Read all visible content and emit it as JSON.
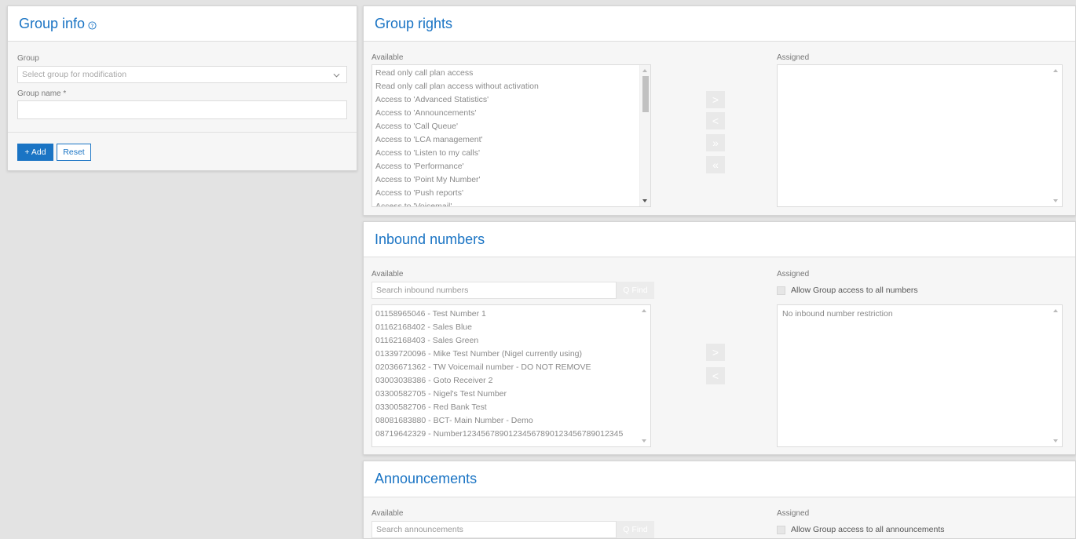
{
  "group_info": {
    "title": "Group info",
    "group_label": "Group",
    "group_placeholder": "Select group for modification",
    "group_name_label": "Group name *",
    "add_label": "+ Add",
    "reset_label": "Reset"
  },
  "group_rights": {
    "title": "Group rights",
    "available_label": "Available",
    "assigned_label": "Assigned",
    "available_items": [
      "Read only call plan access",
      "Read only call plan access without activation",
      "Access to 'Advanced Statistics'",
      "Access to 'Announcements'",
      "Access to 'Call Queue'",
      "Access to 'LCA management'",
      "Access to 'Listen to my calls'",
      "Access to 'Performance'",
      "Access to 'Point My Number'",
      "Access to 'Push reports'",
      "Access to 'Voicemail'"
    ],
    "arrows": [
      ">",
      "<",
      "»",
      "«"
    ]
  },
  "inbound_numbers": {
    "title": "Inbound numbers",
    "available_label": "Available",
    "assigned_label": "Assigned",
    "search_placeholder": "Search inbound numbers",
    "find_label": "Q Find",
    "allow_all_label": "Allow Group access to all numbers",
    "assigned_text": "No inbound number restriction",
    "available_items": [
      "01158965046 - Test Number 1",
      "01162168402 - Sales Blue",
      "01162168403 - Sales Green",
      "01339720096 - Mike Test Number (Nigel currently using)",
      "02036671362 - TW Voicemail number - DO NOT REMOVE",
      "03003038386 - Goto Receiver 2",
      "03300582705 - Nigel's Test Number",
      "03300582706 - Red Bank Test",
      "08081683880 - BCT- Main Number - Demo",
      "08719642329 - Number12345678901234567890123456789012345"
    ],
    "arrows": [
      ">",
      "<"
    ]
  },
  "announcements": {
    "title": "Announcements",
    "available_label": "Available",
    "assigned_label": "Assigned",
    "search_placeholder": "Search announcements",
    "find_label": "Q Find",
    "allow_all_label": "Allow Group access to all announcements"
  },
  "colors": {
    "accent": "#1a74c4",
    "background": "#e3e3e3"
  }
}
